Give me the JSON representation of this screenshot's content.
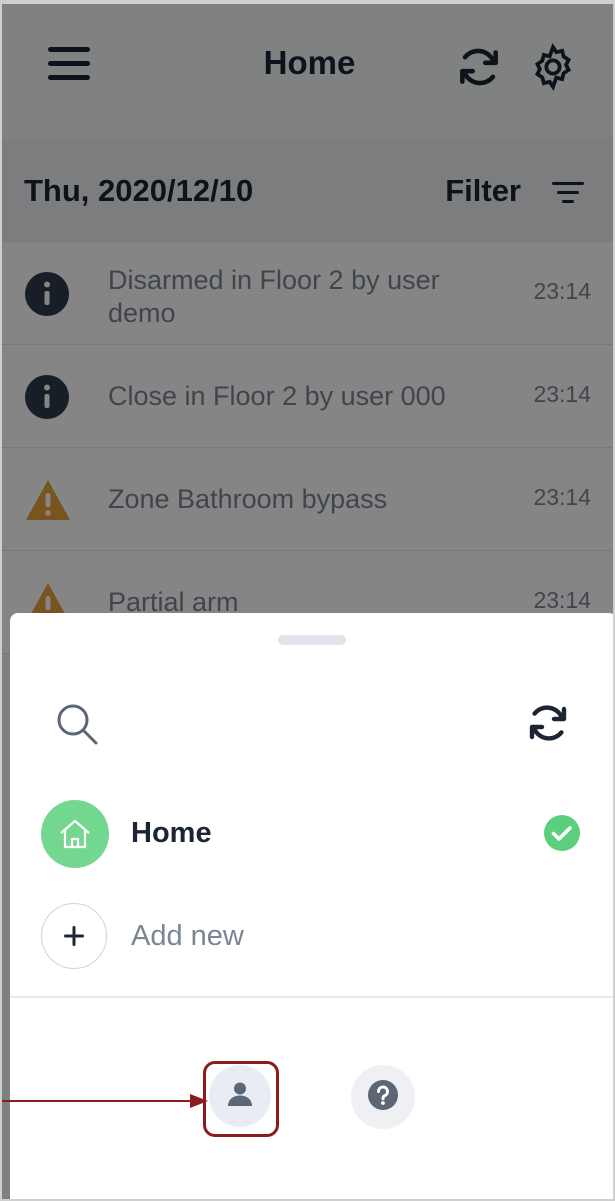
{
  "header": {
    "title": "Home",
    "icons": [
      "menu-icon",
      "refresh-icon",
      "gear-icon"
    ]
  },
  "date_bar": {
    "date": "Thu, 2020/12/10",
    "filter_label": "Filter"
  },
  "events": [
    {
      "icon": "info-icon",
      "text": "Disarmed in Floor 2 by user demo",
      "time": "23:14"
    },
    {
      "icon": "info-icon",
      "text": "Close in Floor 2 by user 000",
      "time": "23:14"
    },
    {
      "icon": "warning-icon",
      "text": "Zone Bathroom bypass",
      "time": "23:14"
    },
    {
      "icon": "warning-icon",
      "text": "Partial arm",
      "time": "23:14"
    }
  ],
  "sheet": {
    "icons": [
      "search-icon",
      "refresh-icon"
    ],
    "sites": [
      {
        "label": "Home",
        "icon": "house-icon",
        "selected": true
      }
    ],
    "add_new_label": "Add new",
    "bottom_actions": [
      "person-icon",
      "help-icon"
    ]
  },
  "colors": {
    "accent_green": "#74d78f",
    "check_green": "#5ccf7e",
    "warning_orange": "#e6a23c",
    "highlight_red": "#8a1c1c"
  }
}
